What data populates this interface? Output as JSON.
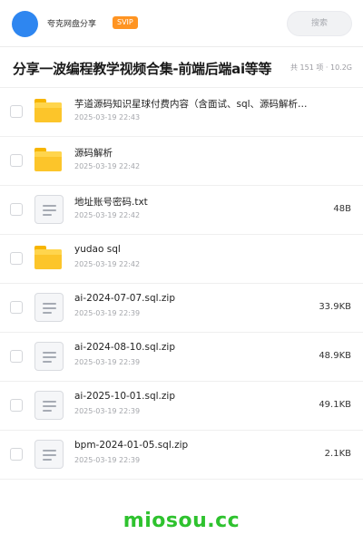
{
  "header": {
    "user_name": "夸克网盘分享",
    "badge": "SVIP",
    "search_label": "搜索"
  },
  "folder": {
    "title": "分享一波编程教学视频合集-前端后端ai等等",
    "meta": "共 151 项 · 10.2G"
  },
  "files": [
    {
      "name": "芋道源码知识星球付费内容（含面试、sql、源码解析…",
      "date": "2025-03-19 22:43",
      "size": "",
      "type": "folder-icon"
    },
    {
      "name": "源码解析",
      "date": "2025-03-19 22:42",
      "size": "",
      "type": "folder-icon"
    },
    {
      "name": "地址账号密码.txt",
      "date": "2025-03-19 22:42",
      "size": "48B",
      "type": "document-icon"
    },
    {
      "name": "yudao sql",
      "date": "2025-03-19 22:42",
      "size": "",
      "type": "folder-icon"
    },
    {
      "name": "ai-2024-07-07.sql.zip",
      "date": "2025-03-19 22:39",
      "size": "33.9KB",
      "type": "document-icon"
    },
    {
      "name": "ai-2024-08-10.sql.zip",
      "date": "2025-03-19 22:39",
      "size": "48.9KB",
      "type": "document-icon"
    },
    {
      "name": "ai-2025-10-01.sql.zip",
      "date": "2025-03-19 22:39",
      "size": "49.1KB",
      "type": "document-icon"
    },
    {
      "name": "bpm-2024-01-05.sql.zip",
      "date": "2025-03-19 22:39",
      "size": "2.1KB",
      "type": "document-icon"
    }
  ],
  "watermark": "miosou.cc",
  "colors": {
    "avatar": "#2e86f0",
    "svip_badge": "#ff9422",
    "folder": "#fcc52a",
    "watermark": "#2ec22e"
  }
}
